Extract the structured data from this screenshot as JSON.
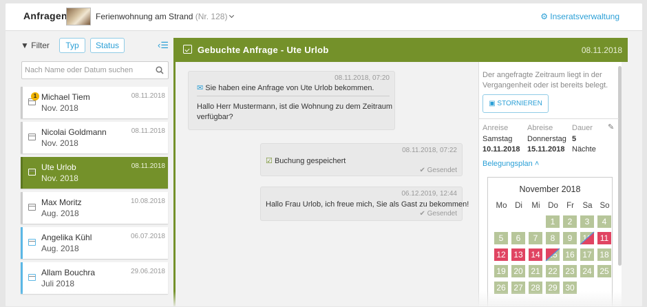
{
  "header": {
    "brand": "Anfragen",
    "property": "Ferienwohnung am Strand",
    "property_num": "(Nr. 128)",
    "management": "Inseratsverwaltung"
  },
  "filter": {
    "label": "Filter",
    "type": "Typ",
    "status": "Status",
    "search_placeholder": "Nach Name oder Datum suchen"
  },
  "inquiries": [
    {
      "name": "Michael Tiem",
      "month": "Nov. 2018",
      "date": "08.11.2018",
      "badge": "1"
    },
    {
      "name": "Nicolai Goldmann",
      "month": "Nov. 2018",
      "date": "08.11.2018"
    },
    {
      "name": "Ute Urlob",
      "month": "Nov. 2018",
      "date": "08.11.2018"
    },
    {
      "name": "Max Moritz",
      "month": "Aug. 2018",
      "date": "10.08.2018"
    },
    {
      "name": "Angelika Kühl",
      "month": "Aug. 2018",
      "date": "06.07.2018"
    },
    {
      "name": "Allam Bouchra",
      "month": "Juli 2018",
      "date": "29.06.2018"
    }
  ],
  "main": {
    "title": "Gebuchte Anfrage - Ute Urlob",
    "date": "08.11.2018"
  },
  "messages": [
    {
      "time": "08.11.2018, 07:20",
      "subject": "Sie haben eine Anfrage von Ute Urlob bekommen.",
      "text": "Hallo Herr Mustermann, ist die Wohnung zu dem Zeitraum verfügbar?"
    },
    {
      "time": "08.11.2018, 07:22",
      "text": "Buchung gespeichert",
      "status": "Gesendet"
    },
    {
      "time": "06.12.2019, 12:44",
      "text": "Hallo Frau Urlob, ich freue mich, Sie als Gast zu bekommen!",
      "status": "Gesendet"
    }
  ],
  "sidebar": {
    "note": "Der angefragte Zeitraum liegt in der Vergangenheit oder ist bereits belegt.",
    "cancel": "STORNIEREN",
    "arrival_label": "Anreise",
    "arrival_day": "Samstag",
    "arrival_date": "10.11.2018",
    "departure_label": "Abreise",
    "departure_day": "Donnerstag",
    "departure_date": "15.11.2018",
    "duration_label": "Dauer",
    "duration_value": "5",
    "duration_unit": "Nächte",
    "plan_link": "Belegungsplan"
  },
  "calendar": {
    "month": "November 2018",
    "weekdays": [
      "Mo",
      "Di",
      "Mi",
      "Do",
      "Fr",
      "Sa",
      "So"
    ],
    "first_weekday": 3,
    "days_shown": 30,
    "booked_red": [
      11,
      12,
      13,
      14
    ],
    "half_red": [
      10,
      15
    ]
  }
}
